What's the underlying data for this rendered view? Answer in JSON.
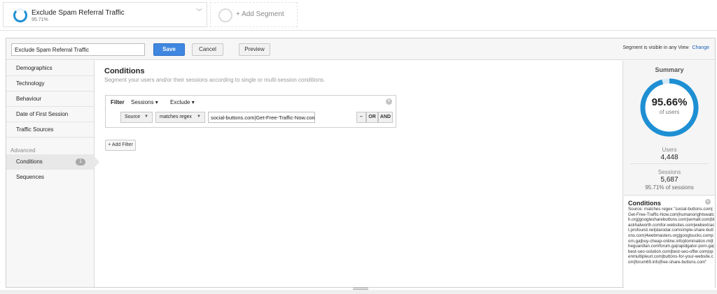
{
  "segments": {
    "active": {
      "title": "Exclude Spam Referral Traffic",
      "percent": "95.71%"
    },
    "add_label": "+ Add Segment"
  },
  "toolbar": {
    "name_value": "Exclude Spam Referral Traffic",
    "save_label": "Save",
    "cancel_label": "Cancel",
    "preview_label": "Preview",
    "visibility_text": "Segment is visible in any View",
    "change_label": "Change"
  },
  "nav": {
    "items": [
      {
        "label": "Demographics"
      },
      {
        "label": "Technology"
      },
      {
        "label": "Behaviour"
      },
      {
        "label": "Date of First Session"
      },
      {
        "label": "Traffic Sources"
      }
    ],
    "advanced_label": "Advanced",
    "advanced_items": [
      {
        "label": "Conditions",
        "badge": "1",
        "selected": true
      },
      {
        "label": "Sequences"
      }
    ]
  },
  "main": {
    "title": "Conditions",
    "description": "Segment your users and/or their sessions according to single or multi-session conditions.",
    "filter": {
      "label": "Filter",
      "scope": "Sessions",
      "mode": "Exclude",
      "dimension": "Source",
      "operator": "matches regex",
      "value": "social-buttons.com|Get-Free-Traffic-Now.com|humanorightswatch.org|googlesharebuttons.com",
      "minus_label": "–",
      "or_label": "OR",
      "and_label": "AND"
    },
    "add_filter_label": "+ Add Filter"
  },
  "summary": {
    "title": "Summary",
    "percent": "95.66%",
    "percent_value": 95.66,
    "of_users": "of users",
    "users_label": "Users",
    "users_value": "4,448",
    "sessions_label": "Sessions",
    "sessions_value": "5,687",
    "sessions_pct": "95.71% of sessions",
    "conditions_title": "Conditions",
    "conditions_text": "Source: matches regex \"social-buttons.com|Get-Free-Traffic-Now.com|humanorightswatch.org|googlesharebuttons.com|semalt.com|blackhatworth.comfor-websites.com|webextract.profound.net|darodar.comsimple-share-buttons.com|4webmasters.org|googlsucks.comporn.ga|buy-cheap-online.info|domination.ml|theguardlan.comforum.ga|rapidgator-porn.ga|best-seo-solution.com|best-seo-offer.com|openmultipleurl.com|buttons-for-your-website.com|forum69.info|free-share-buttons.com\""
  },
  "colors": {
    "accent": "#1e8fd3",
    "save_button": "#3f87e1",
    "link": "#1a5fb4"
  }
}
